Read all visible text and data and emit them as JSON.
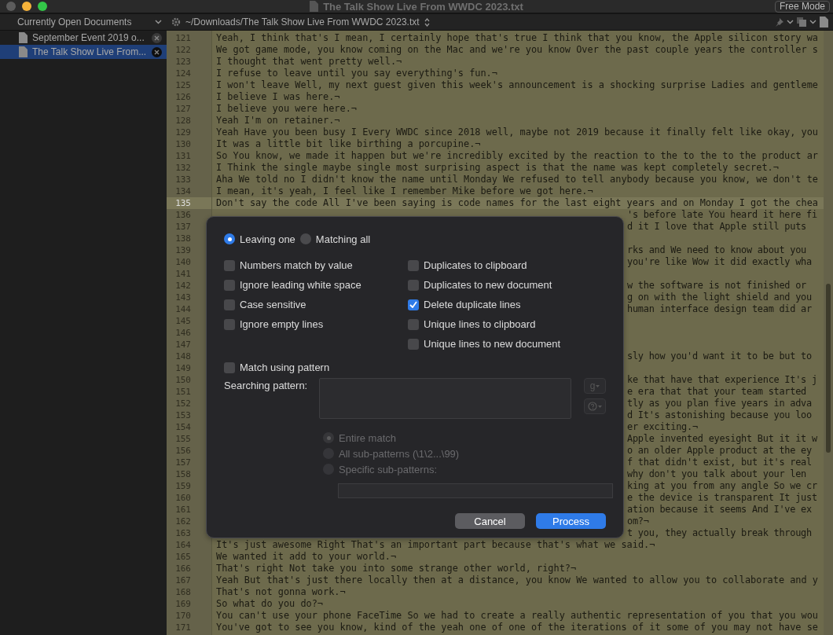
{
  "window": {
    "title": "The Talk Show Live From WWDC 2023.txt",
    "mode_button": "Free Mode"
  },
  "sidebar": {
    "header": "Currently Open Documents",
    "documents": [
      {
        "name": "September Event 2019 o...",
        "selected": false
      },
      {
        "name": "The Talk Show Live From...",
        "selected": true
      }
    ]
  },
  "path_bar": {
    "path": "~/Downloads/The Talk Show Live From WWDC 2023.txt"
  },
  "editor": {
    "lines": [
      {
        "number": "121",
        "kind": "full",
        "current": false,
        "text": "Yeah, I think that's I mean, I certainly hope that's true I think that you know, the Apple silicon story wa"
      },
      {
        "number": "122",
        "kind": "full",
        "current": false,
        "text": "We got game mode, you know coming on the Mac and we're you know Over the past couple years the controller s"
      },
      {
        "number": "123",
        "kind": "full",
        "current": false,
        "text": "I thought that went pretty well.¬"
      },
      {
        "number": "124",
        "kind": "full",
        "current": false,
        "text": "I refuse to leave until you say everything's fun.¬"
      },
      {
        "number": "125",
        "kind": "full",
        "current": false,
        "text": "I won't leave Well, my next guest given this week's announcement is a shocking surprise Ladies and gentleme"
      },
      {
        "number": "126",
        "kind": "full",
        "current": false,
        "text": "I believe I was here.¬"
      },
      {
        "number": "127",
        "kind": "full",
        "current": false,
        "text": "I believe you were here.¬"
      },
      {
        "number": "128",
        "kind": "full",
        "current": false,
        "text": "Yeah I'm on retainer.¬"
      },
      {
        "number": "129",
        "kind": "full",
        "current": false,
        "text": "Yeah Have you been busy I Every WWDC since 2018 well, maybe not 2019 because it finally felt like okay, you"
      },
      {
        "number": "130",
        "kind": "full",
        "current": false,
        "text": "It was a little bit like birthing a porcupine.¬"
      },
      {
        "number": "131",
        "kind": "full",
        "current": false,
        "text": "So You know, we made it happen but we're incredibly excited by the reaction to the to the to the product ar"
      },
      {
        "number": "132",
        "kind": "full",
        "current": false,
        "text": "I Think the single maybe single most surprising aspect is that the name was kept completely secret.¬"
      },
      {
        "number": "133",
        "kind": "full",
        "current": false,
        "text": "Aha We told no I didn't know the name until Monday We refused to tell anybody because you know, we don't te"
      },
      {
        "number": "134",
        "kind": "full",
        "current": false,
        "text": "I mean, it's yeah, I feel like I remember Mike before we got here.¬"
      },
      {
        "number": "135",
        "kind": "full",
        "current": true,
        "text": "Don't say the code All I've been saying is code names for the last eight years and on Monday I got the chea"
      },
      {
        "number": "136",
        "kind": "partial",
        "current": false,
        "text": "'s before late You heard it here fi"
      },
      {
        "number": "137",
        "kind": "partial",
        "current": false,
        "text": "d it I love that Apple still puts"
      },
      {
        "number": "138",
        "kind": "partial",
        "current": false
      },
      {
        "number": "139",
        "kind": "partial",
        "current": false,
        "text": "rks and We need to know about you"
      },
      {
        "number": "140",
        "kind": "partial",
        "current": false,
        "text": "you're like Wow it did exactly wha"
      },
      {
        "number": "141",
        "kind": "partial",
        "current": false
      },
      {
        "number": "142",
        "kind": "partial",
        "current": false,
        "text": "w the software is not finished or"
      },
      {
        "number": "143",
        "kind": "partial",
        "current": false,
        "text": "g on with the light shield and you"
      },
      {
        "number": "144",
        "kind": "partial",
        "current": false,
        "text": "human interface design team did ar"
      },
      {
        "number": "145",
        "kind": "partial",
        "current": false
      },
      {
        "number": "146",
        "kind": "partial",
        "current": false
      },
      {
        "number": "147",
        "kind": "partial",
        "current": false
      },
      {
        "number": "148",
        "kind": "partial",
        "current": false,
        "text": "sly how you'd want it to be but to"
      },
      {
        "number": "149",
        "kind": "partial",
        "current": false
      },
      {
        "number": "150",
        "kind": "partial",
        "current": false,
        "text": "ke that have that experience It's j"
      },
      {
        "number": "151",
        "kind": "partial",
        "current": false,
        "text": "e era that that your team started"
      },
      {
        "number": "152",
        "kind": "partial",
        "current": false,
        "text": "tly as you plan five years in adva"
      },
      {
        "number": "153",
        "kind": "partial",
        "current": false,
        "text": "d It's astonishing because you loo"
      },
      {
        "number": "154",
        "kind": "partial",
        "current": false,
        "text": "er exciting.¬"
      },
      {
        "number": "155",
        "kind": "partial",
        "current": false,
        "text": "Apple invented eyesight But it it w"
      },
      {
        "number": "156",
        "kind": "partial",
        "current": false,
        "text": "o an older Apple product at the ey"
      },
      {
        "number": "157",
        "kind": "partial",
        "current": false,
        "text": "f that didn't exist, but it's real"
      },
      {
        "number": "158",
        "kind": "partial",
        "current": false,
        "text": "why don't you talk about your len"
      },
      {
        "number": "159",
        "kind": "partial",
        "current": false,
        "text": "king at you from any angle So we cr"
      },
      {
        "number": "160",
        "kind": "partial",
        "current": false,
        "text": "e the device is transparent It just"
      },
      {
        "number": "161",
        "kind": "partial",
        "current": false,
        "text": "ation because it seems And I've ex"
      },
      {
        "number": "162",
        "kind": "partial",
        "current": false,
        "text": "om?¬"
      },
      {
        "number": "163",
        "kind": "partial",
        "current": false,
        "text": "t you, they actually break through"
      },
      {
        "number": "164",
        "kind": "full",
        "current": false,
        "text": "It's just awesome Right That's an important part because that's what we said.¬"
      },
      {
        "number": "165",
        "kind": "full",
        "current": false,
        "text": "We wanted it add to your world.¬"
      },
      {
        "number": "166",
        "kind": "full",
        "current": false,
        "text": "That's right Not take you into some strange other world, right?¬"
      },
      {
        "number": "167",
        "kind": "full",
        "current": false,
        "text": "Yeah But that's just there locally then at a distance, you know We wanted to allow you to collaborate and y"
      },
      {
        "number": "168",
        "kind": "full",
        "current": false,
        "text": "That's not gonna work.¬"
      },
      {
        "number": "169",
        "kind": "full",
        "current": false,
        "text": "So what do you do?¬"
      },
      {
        "number": "170",
        "kind": "full",
        "current": false,
        "text": "You can't use your phone FaceTime So we had to create a really authentic representation of you that you wou"
      },
      {
        "number": "171",
        "kind": "full",
        "current": false,
        "text": "You've got to see you know, kind of the yeah one of one of the iterations of it some of you may not have se"
      }
    ]
  },
  "dialog": {
    "modes": [
      {
        "label": "Leaving one",
        "selected": true
      },
      {
        "label": "Matching all",
        "selected": false
      }
    ],
    "left_options": [
      {
        "label": "Numbers match by value",
        "checked": false
      },
      {
        "label": "Ignore leading white space",
        "checked": false
      },
      {
        "label": "Case sensitive",
        "checked": false
      },
      {
        "label": "Ignore empty lines",
        "checked": false
      }
    ],
    "right_options": [
      {
        "label": "Duplicates to clipboard",
        "checked": false
      },
      {
        "label": "Duplicates to new document",
        "checked": false
      },
      {
        "label": "Delete duplicate lines",
        "checked": true
      },
      {
        "label": "Unique lines to clipboard",
        "checked": false
      },
      {
        "label": "Unique lines to new document",
        "checked": false
      }
    ],
    "pattern_option": {
      "label": "Match using pattern",
      "checked": false
    },
    "pattern_label": "Searching pattern:",
    "pattern_menu": "g",
    "sub_options": [
      {
        "label": "Entire match",
        "selected": true,
        "disabled": true
      },
      {
        "label": "All sub-patterns (\\1\\2...\\99)",
        "selected": false,
        "disabled": true
      },
      {
        "label": "Specific sub-patterns:",
        "selected": false,
        "disabled": true
      }
    ],
    "buttons": [
      {
        "label": "Cancel",
        "kind": "secondary"
      },
      {
        "label": "Process",
        "kind": "primary"
      }
    ]
  }
}
